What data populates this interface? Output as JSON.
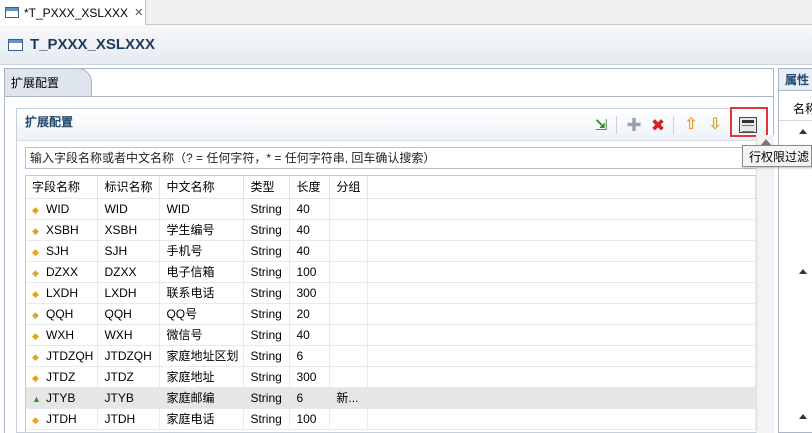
{
  "editor_tab": {
    "label": "*T_PXXX_XSLXXX",
    "close_icon": "close-icon"
  },
  "title": "T_PXXX_XSLXXX",
  "left_tab": "扩展配置",
  "section": {
    "title": "扩展配置",
    "toolbar": {
      "icons": [
        "export-icon",
        "add-icon",
        "delete-icon",
        "move-up-icon",
        "move-down-icon",
        "row-filter-icon"
      ],
      "highlight_color": "#e23636"
    },
    "search": {
      "placeholder": "输入字段名称或者中文名称（? = 任何字符，* = 任何字符串, 回车确认搜索）"
    }
  },
  "table": {
    "headers": [
      "字段名称",
      "标识名称",
      "中文名称",
      "类型",
      "长度",
      "分组"
    ],
    "rows": [
      {
        "marker": "diamond",
        "field": "WID",
        "ident": "WID",
        "cname": "WID",
        "type": "String",
        "length": "40",
        "group": ""
      },
      {
        "marker": "diamond",
        "field": "XSBH",
        "ident": "XSBH",
        "cname": "学生编号",
        "type": "String",
        "length": "40",
        "group": ""
      },
      {
        "marker": "diamond",
        "field": "SJH",
        "ident": "SJH",
        "cname": "手机号",
        "type": "String",
        "length": "40",
        "group": ""
      },
      {
        "marker": "diamond",
        "field": "DZXX",
        "ident": "DZXX",
        "cname": "电子信箱",
        "type": "String",
        "length": "100",
        "group": ""
      },
      {
        "marker": "diamond",
        "field": "LXDH",
        "ident": "LXDH",
        "cname": "联系电话",
        "type": "String",
        "length": "300",
        "group": ""
      },
      {
        "marker": "diamond",
        "field": "QQH",
        "ident": "QQH",
        "cname": "QQ号",
        "type": "String",
        "length": "20",
        "group": ""
      },
      {
        "marker": "diamond",
        "field": "WXH",
        "ident": "WXH",
        "cname": "微信号",
        "type": "String",
        "length": "40",
        "group": ""
      },
      {
        "marker": "diamond",
        "field": "JTDZQH",
        "ident": "JTDZQH",
        "cname": "家庭地址区划",
        "type": "String",
        "length": "6",
        "group": ""
      },
      {
        "marker": "diamond",
        "field": "JTDZ",
        "ident": "JTDZ",
        "cname": "家庭地址",
        "type": "String",
        "length": "300",
        "group": ""
      },
      {
        "marker": "triangle",
        "field": "JTYB",
        "ident": "JTYB",
        "cname": "家庭邮编",
        "type": "String",
        "length": "6",
        "group": "新...",
        "selected": true
      },
      {
        "marker": "diamond",
        "field": "JTDH",
        "ident": "JTDH",
        "cname": "家庭电话",
        "type": "String",
        "length": "100",
        "group": ""
      }
    ]
  },
  "right_panel": {
    "title": "属性",
    "sub_label": "名称"
  },
  "tooltip": "行权限过滤"
}
